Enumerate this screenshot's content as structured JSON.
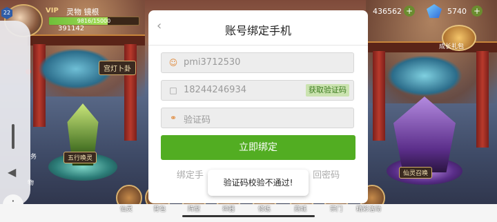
{
  "header": {
    "level": "22",
    "vip": "VIP",
    "player_name": "灵物 镜根",
    "exp_text": "9816/15000",
    "exp_progress": 0.6544,
    "power": "391142",
    "gold": "436562",
    "gem": "5740",
    "plus": "+",
    "growth_label": "成长礼包"
  },
  "scene": {
    "left_sign": "宫灯卜卦",
    "right_sign": "仙灵召唤",
    "spirit_sign": "五行唤灵",
    "side_labels": [
      "务",
      "物"
    ]
  },
  "bottom_nav": {
    "items": [
      "仙灵",
      "背包",
      "阵型",
      "神器",
      "修炼",
      "商城",
      "宗门",
      "精彩活动"
    ]
  },
  "dialog": {
    "back_icon": "‹",
    "title": "账号绑定手机",
    "account_value": "pmi3712530",
    "phone_value": "18244246934",
    "get_code_label": "获取验证码",
    "code_placeholder": "验证码",
    "submit_label": "立即绑定",
    "footer_left": "绑定手",
    "footer_right": "回密码"
  },
  "toast": {
    "message": "验证码校验不通过!"
  },
  "side_panel": {
    "more_icon": "⋮",
    "volume_icon": "◀"
  },
  "colors": {
    "accent_green": "#52ad22",
    "code_button_bg": "#cbe3b0",
    "field_icon": "#e0893a"
  }
}
